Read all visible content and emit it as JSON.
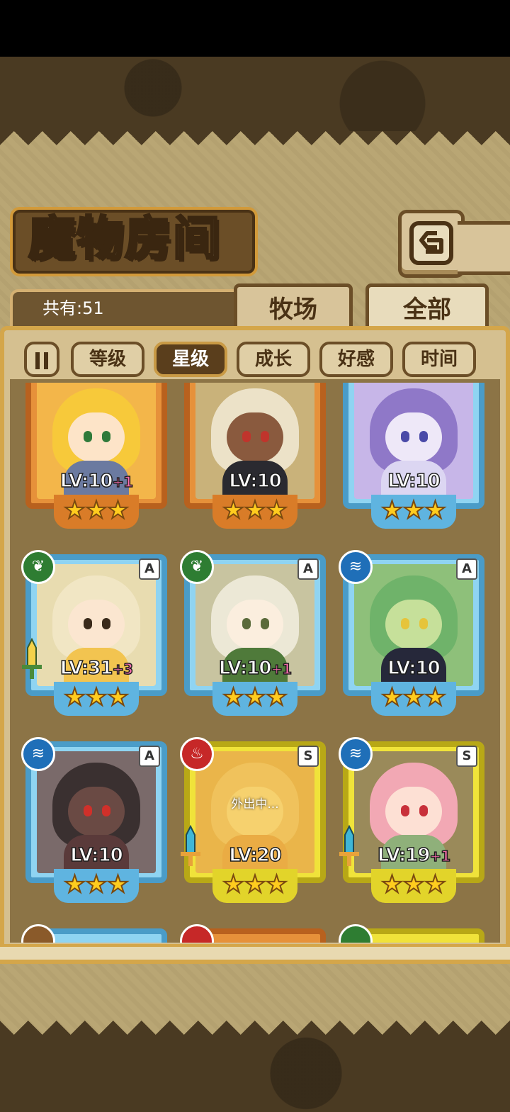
{
  "title": "魔物房间",
  "total_count": "共有:51",
  "tabs": {
    "pasture": "牧场",
    "all": "全部"
  },
  "sort_buttons": [
    "等级",
    "星级",
    "成长",
    "好感",
    "时间"
  ],
  "active_sort": "星级",
  "colors": {
    "parchment": "#b9a674",
    "frame_orange": "#e6913a",
    "frame_blue": "#8fd4f2",
    "frame_yellow": "#f0e33a",
    "plus_pink": "#ff6fb0"
  },
  "cards": [
    {
      "lv": "LV:10",
      "plus": "+1",
      "stars": "★★★",
      "rank": "",
      "element": "fire-icon"
    },
    {
      "lv": "LV:10",
      "plus": "",
      "stars": "★★★",
      "rank": "",
      "element": "earth-icon"
    },
    {
      "lv": "LV:10",
      "plus": "",
      "stars": "★★★",
      "rank": "",
      "element": "water-icon"
    },
    {
      "lv": "LV:31",
      "plus": "+3",
      "stars": "★★★",
      "rank": "A",
      "element": "leaf-icon"
    },
    {
      "lv": "LV:10",
      "plus": "+1",
      "stars": "★★★",
      "rank": "A",
      "element": "leaf-icon"
    },
    {
      "lv": "LV:10",
      "plus": "",
      "stars": "★★★",
      "rank": "A",
      "element": "water-icon"
    },
    {
      "lv": "LV:10",
      "plus": "",
      "stars": "★★★",
      "rank": "A",
      "element": "water-icon"
    },
    {
      "lv": "LV:20",
      "plus": "",
      "stars": "★★★",
      "rank": "S",
      "element": "fire-icon",
      "status": "外出中..."
    },
    {
      "lv": "LV:19",
      "plus": "+1",
      "stars": "★★★",
      "rank": "S",
      "element": "water-icon"
    }
  ]
}
